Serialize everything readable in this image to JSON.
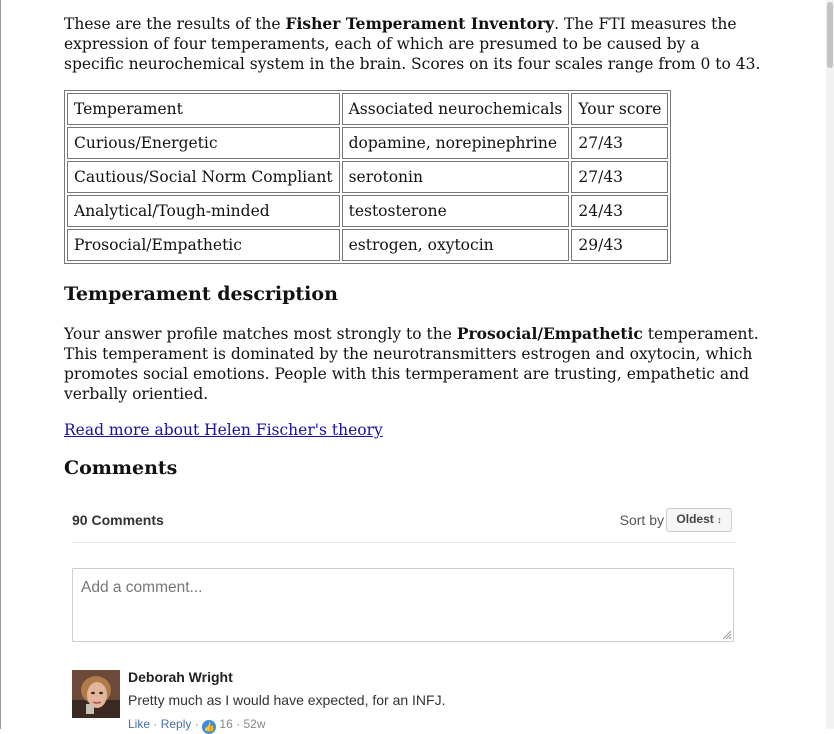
{
  "intro": {
    "text_1": "These are the results of the ",
    "bold_1": "Fisher Temperament Inventory",
    "text_2": ". The FTI measures the expression of four temperaments, each of which are presumed to be caused by a specific neurochemical system in the brain. Scores on its four scales range from 0 to 43."
  },
  "results_table": {
    "headers": [
      "Temperament",
      "Associated neurochemicals",
      "Your score"
    ],
    "rows": [
      [
        "Curious/Energetic",
        "dopamine, norepinephrine",
        "27/43"
      ],
      [
        "Cautious/Social Norm Compliant",
        "serotonin",
        "27/43"
      ],
      [
        "Analytical/Tough-minded",
        "testosterone",
        "24/43"
      ],
      [
        "Prosocial/Empathetic",
        "estrogen, oxytocin",
        "29/43"
      ]
    ]
  },
  "description": {
    "heading": "Temperament description",
    "text_1": "Your answer profile matches most strongly to the ",
    "bold_1": "Prosocial/Empathetic",
    "text_2": " temperament. This temperament is dominated by the neurotransmitters estrogen and oxytocin, which promotes social emotions. People with this termperament are trusting, empathetic and verbally orientied."
  },
  "read_more_link": "Read more about Helen Fischer's theory",
  "comments": {
    "heading": "Comments",
    "count_label": "90 Comments",
    "sort_label": "Sort by",
    "sort_value": "Oldest",
    "sort_arrow": "↕",
    "new_comment_placeholder": "Add a comment...",
    "items": [
      {
        "author": "Deborah Wright",
        "text": "Pretty much as I would have expected, for an INFJ.",
        "like_label": "Like",
        "reply_label": "Reply",
        "like_count": "16",
        "age": "52w",
        "sep": "·"
      }
    ]
  },
  "colors": {
    "link": "#1a0dab",
    "comment_action": "#4a6fa5",
    "like_badge": "#3b8edb"
  }
}
